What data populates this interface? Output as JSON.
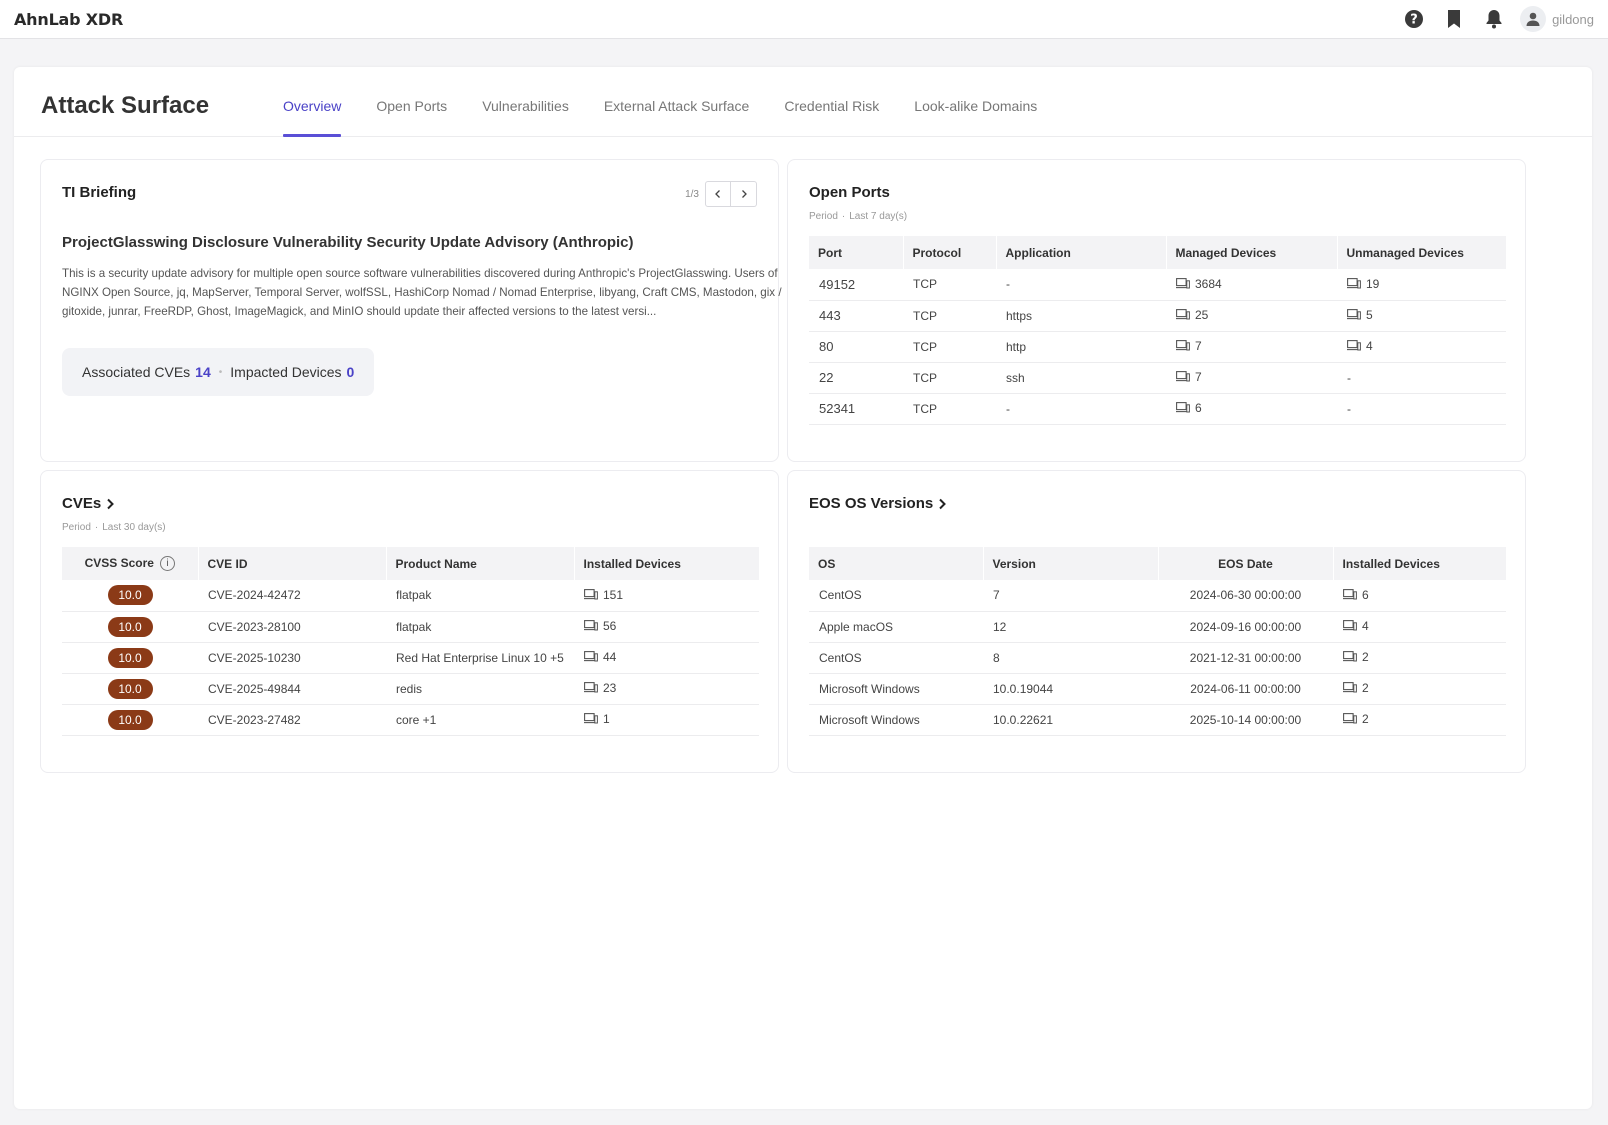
{
  "app": {
    "logo": "AhnLab XDR",
    "user": "gildong"
  },
  "page": {
    "title": "Attack Surface",
    "tabs": [
      "Overview",
      "Open Ports",
      "Vulnerabilities",
      "External Attack Surface",
      "Credential Risk",
      "Look-alike Domains"
    ],
    "active_tab": "Overview"
  },
  "ti_briefing": {
    "title": "TI Briefing",
    "pager": "1/3",
    "headline": "ProjectGlasswing Disclosure Vulnerability Security Update Advisory (Anthropic)",
    "body": "This is a security update advisory for multiple open source software vulnerabilities discovered during Anthropic's ProjectGlasswing. Users of NGINX Open Source, jq, MapServer, Temporal Server, wolfSSL, HashiCorp Nomad / Nomad Enterprise, libyang, Craft CMS, Mastodon, gix / gitoxide, junrar, FreeRDP, Ghost, ImageMagick, and MinIO should update their affected versions to the latest versi...",
    "associated_label": "Associated CVEs",
    "associated_value": "14",
    "impacted_label": "Impacted Devices",
    "impacted_value": "0"
  },
  "open_ports": {
    "title": "Open Ports",
    "period_label": "Period",
    "period_value": "Last 7 day(s)",
    "columns": [
      "Port",
      "Protocol",
      "Application",
      "Managed Devices",
      "Unmanaged Devices"
    ],
    "rows": [
      {
        "port": "49152",
        "protocol": "TCP",
        "application": "-",
        "managed": "3684",
        "unmanaged": "19"
      },
      {
        "port": "443",
        "protocol": "TCP",
        "application": "https",
        "managed": "25",
        "unmanaged": "5"
      },
      {
        "port": "80",
        "protocol": "TCP",
        "application": "http",
        "managed": "7",
        "unmanaged": "4"
      },
      {
        "port": "22",
        "protocol": "TCP",
        "application": "ssh",
        "managed": "7",
        "unmanaged": "-"
      },
      {
        "port": "52341",
        "protocol": "TCP",
        "application": "-",
        "managed": "6",
        "unmanaged": "-"
      }
    ]
  },
  "cves": {
    "title": "CVEs",
    "period_label": "Period",
    "period_value": "Last 30 day(s)",
    "columns": [
      "CVSS Score",
      "CVE ID",
      "Product Name",
      "Installed Devices"
    ],
    "rows": [
      {
        "score": "10.0",
        "cve_id": "CVE-2024-42472",
        "product": "flatpak",
        "devices": "151"
      },
      {
        "score": "10.0",
        "cve_id": "CVE-2023-28100",
        "product": "flatpak",
        "devices": "56"
      },
      {
        "score": "10.0",
        "cve_id": "CVE-2025-10230",
        "product": "Red Hat Enterprise Linux 10 +5",
        "devices": "44"
      },
      {
        "score": "10.0",
        "cve_id": "CVE-2025-49844",
        "product": "redis",
        "devices": "23"
      },
      {
        "score": "10.0",
        "cve_id": "CVE-2023-27482",
        "product": "core +1",
        "devices": "1"
      }
    ]
  },
  "eos": {
    "title": "EOS OS Versions",
    "columns": [
      "OS",
      "Version",
      "EOS Date",
      "Installed Devices"
    ],
    "rows": [
      {
        "os": "CentOS",
        "version": "7",
        "eos_date": "2024-06-30 00:00:00",
        "devices": "6"
      },
      {
        "os": "Apple macOS",
        "version": "12",
        "eos_date": "2024-09-16 00:00:00",
        "devices": "4"
      },
      {
        "os": "CentOS",
        "version": "8",
        "eos_date": "2021-12-31 00:00:00",
        "devices": "2"
      },
      {
        "os": "Microsoft Windows",
        "version": "10.0.19044",
        "eos_date": "2024-06-11 00:00:00",
        "devices": "2"
      },
      {
        "os": "Microsoft Windows",
        "version": "10.0.22621",
        "eos_date": "2025-10-14 00:00:00",
        "devices": "2"
      }
    ]
  },
  "colors": {
    "accent": "#4a42c7",
    "score_badge": "#8b3a17"
  },
  "icons": [
    "help-icon",
    "bookmark-icon",
    "bell-icon",
    "user-icon",
    "chevron-left-icon",
    "chevron-right-icon",
    "device-icon",
    "info-icon"
  ]
}
